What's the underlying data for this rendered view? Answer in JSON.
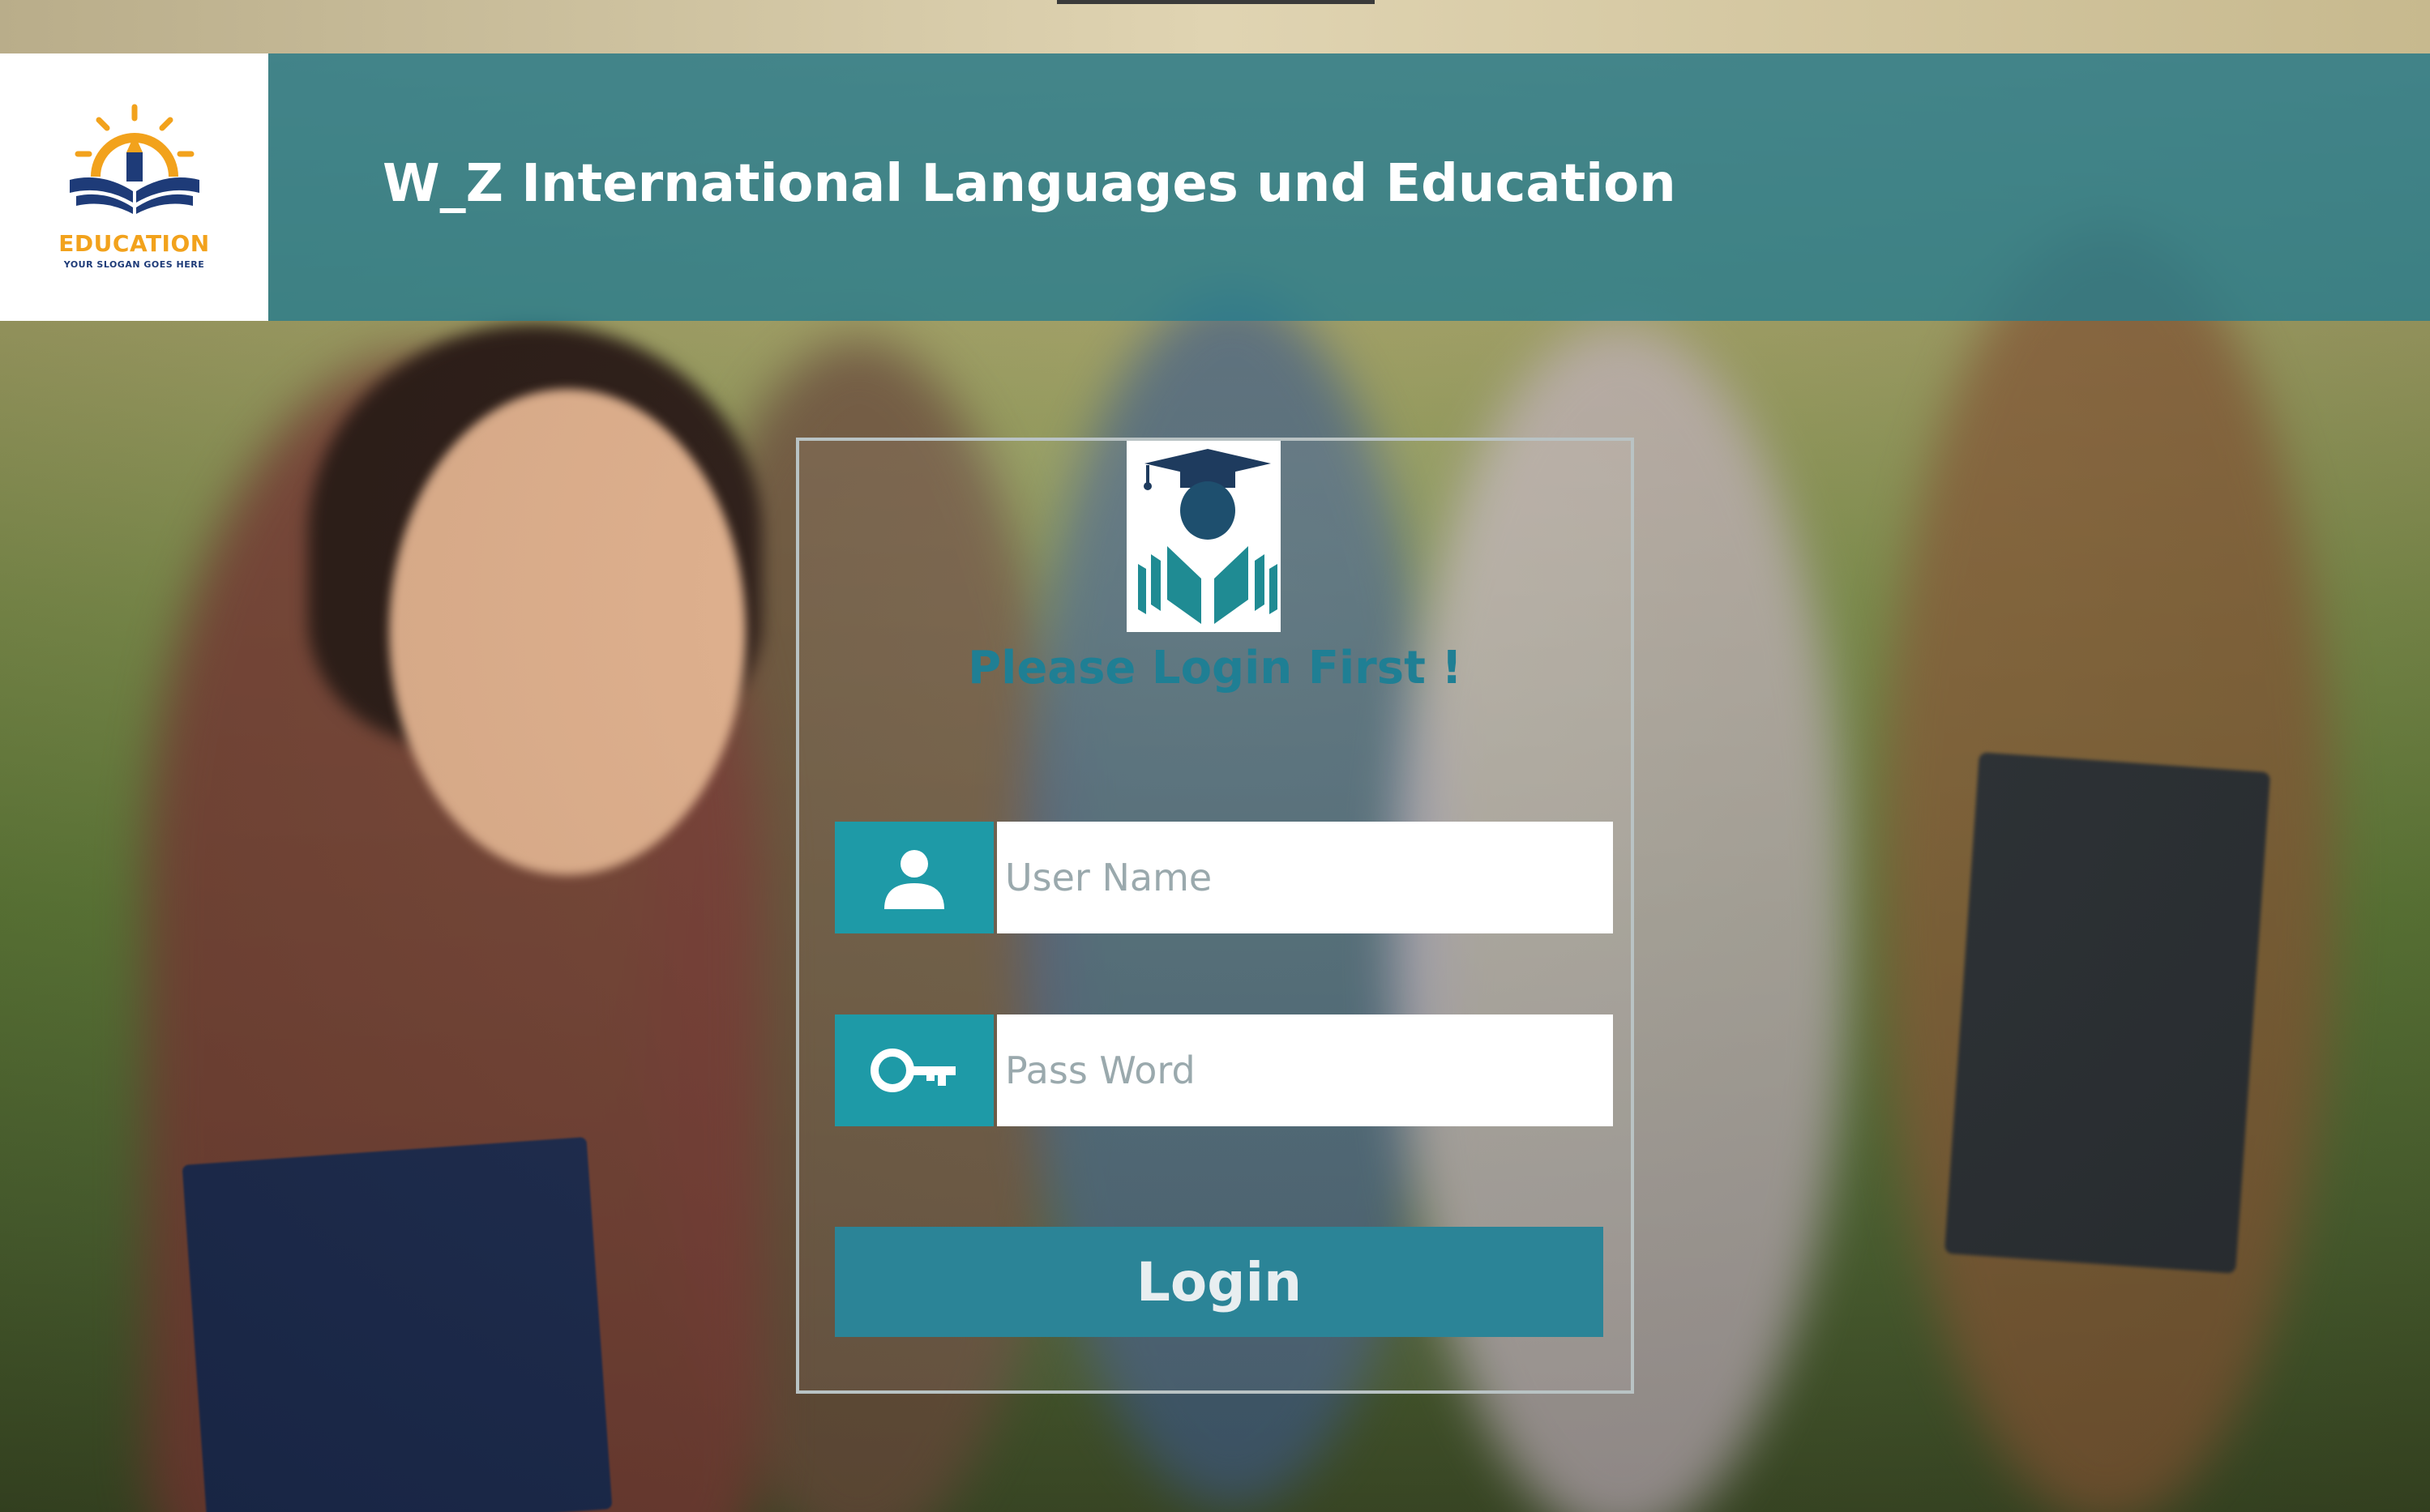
{
  "header": {
    "title": "W_Z International Languages und Education",
    "logo_word": "EDUCATION",
    "logo_slogan": "YOUR SLOGAN GOES HERE"
  },
  "login": {
    "heading": "Please Login First !",
    "username_placeholder": "User Name",
    "username_value": "",
    "password_placeholder": "Pass Word",
    "password_value": "",
    "button_label": "Login"
  },
  "icons": {
    "logo": "education-logo-icon",
    "panel_logo": "graduation-book-icon",
    "user": "user-icon",
    "password": "key-icon"
  },
  "colors": {
    "header": "#297d8c",
    "accent": "#1f7f94",
    "icon_box": "#1e9aa7",
    "button": "#2b8497",
    "logo_orange": "#f2a21c",
    "logo_blue": "#1e3b78"
  }
}
